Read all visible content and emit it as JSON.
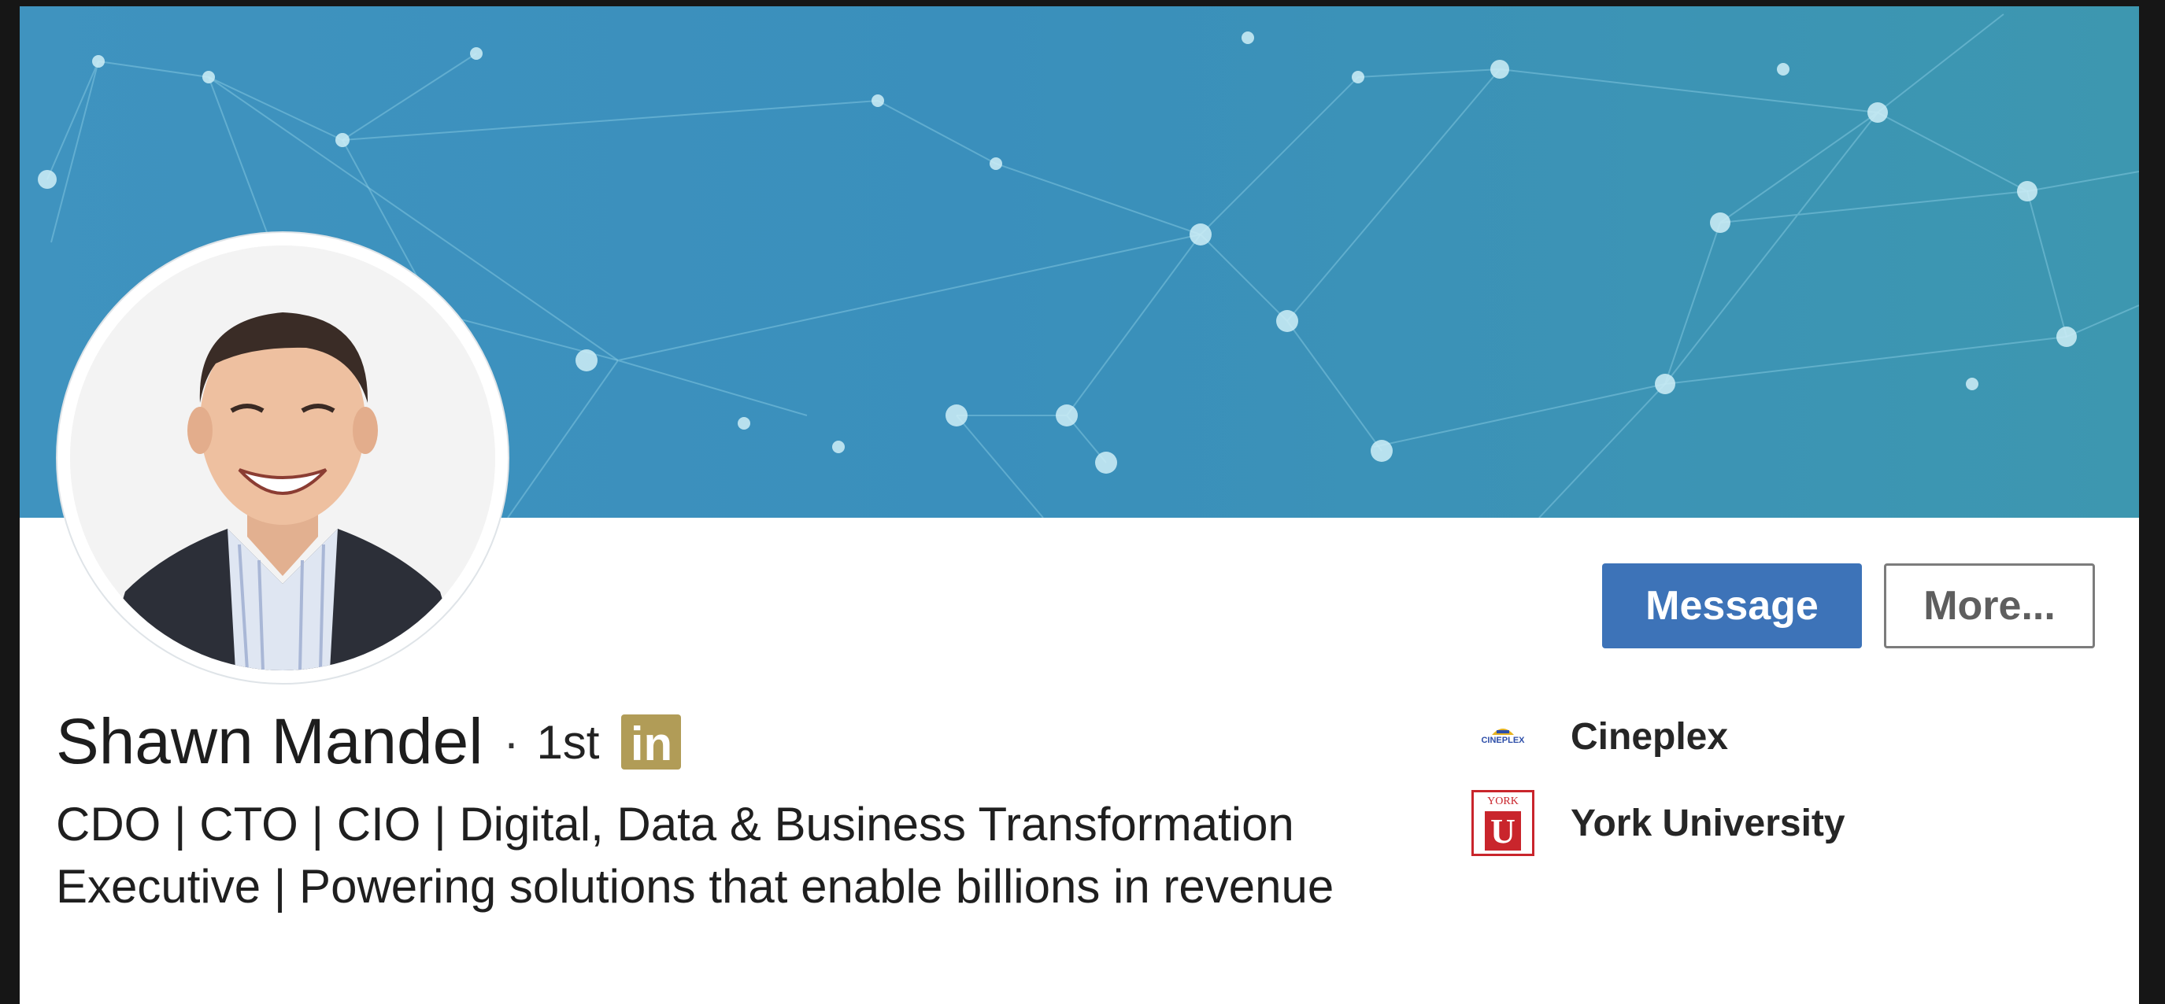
{
  "profile": {
    "name": "Shawn Mandel",
    "separator": "·",
    "connection_degree": "1st",
    "premium_badge": "in",
    "headline": "CDO | CTO | CIO | Digital, Data & Business Transformation Executive | Powering solutions that enable billions in revenue"
  },
  "actions": {
    "message_label": "Message",
    "more_label": "More..."
  },
  "organizations": [
    {
      "name": "Cineplex",
      "logo_icon": "cineplex-logo-icon",
      "logo_text": "CINEPLEX"
    },
    {
      "name": "York University",
      "logo_icon": "york-university-logo-icon",
      "logo_top": "YORK",
      "logo_letter": "U"
    }
  ],
  "colors": {
    "banner": "#3c92bc",
    "primary_button": "#3d73b8",
    "premium_gold": "#b19c57",
    "york_red": "#c9252c"
  },
  "icons": {
    "banner": "network-pattern-banner",
    "avatar": "profile-photo-avatar",
    "premium": "linkedin-premium-icon"
  }
}
